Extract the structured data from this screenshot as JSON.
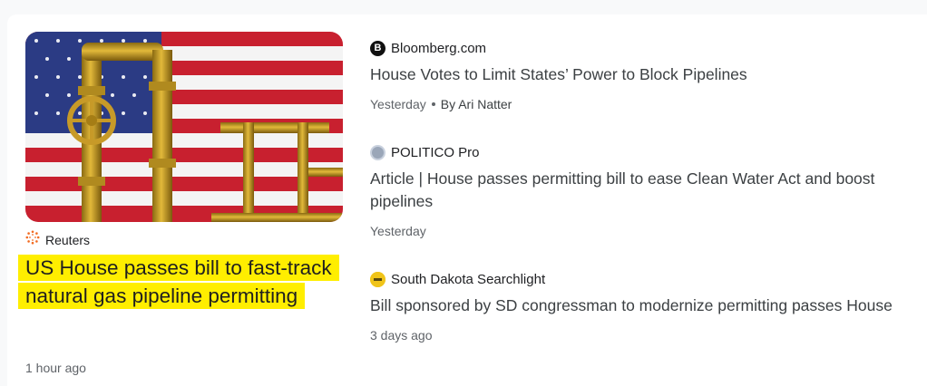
{
  "featured": {
    "source": "Reuters",
    "source_icon": "reuters-icon",
    "title": "US House passes bill to fast-track natural gas pipeline permitting",
    "time": "1 hour ago",
    "highlight_color": "#ffee00"
  },
  "related": [
    {
      "source": "Bloomberg.com",
      "source_icon": "bloomberg-icon",
      "logo_letter": "B",
      "title": "House Votes to Limit States’ Power to Block Pipelines",
      "time": "Yesterday",
      "byline": "By Ari Natter"
    },
    {
      "source": "POLITICO Pro",
      "source_icon": "politico-icon",
      "title": "Article | House passes permitting bill to ease Clean Water Act and boost pipelines",
      "time": "Yesterday"
    },
    {
      "source": "South Dakota Searchlight",
      "source_icon": "sd-searchlight-icon",
      "title": "Bill sponsored by SD congressman to modernize permitting passes House",
      "time": "3 days ago"
    }
  ]
}
